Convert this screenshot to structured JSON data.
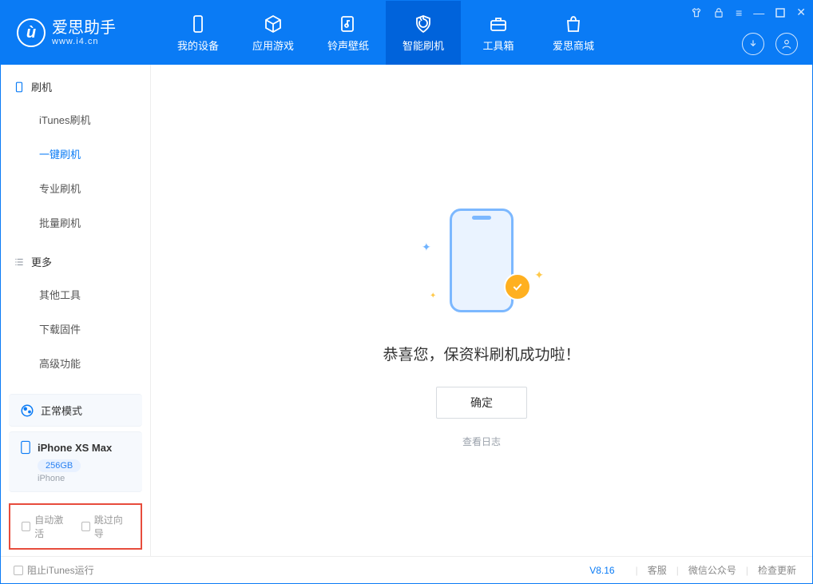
{
  "colors": {
    "primary": "#0a7bf5",
    "danger_border": "#e74c3c"
  },
  "logo": {
    "glyph": "ù",
    "title": "爱思助手",
    "subtitle": "www.i4.cn"
  },
  "tabs": {
    "mydevice": "我的设备",
    "apps": "应用游戏",
    "ring": "铃声壁纸",
    "flash": "智能刷机",
    "toolbox": "工具箱",
    "store": "爱思商城"
  },
  "sidebar": {
    "section1": "刷机",
    "items1": {
      "itunes": "iTunes刷机",
      "onekey": "一键刷机",
      "pro": "专业刷机",
      "batch": "批量刷机"
    },
    "section2": "更多",
    "items2": {
      "other": "其他工具",
      "download": "下载固件",
      "adv": "高级功能"
    }
  },
  "device": {
    "mode": "正常模式",
    "name": "iPhone XS Max",
    "capacity": "256GB",
    "type": "iPhone"
  },
  "options": {
    "auto_activate": "自动激活",
    "skip_guide": "跳过向导"
  },
  "main": {
    "message": "恭喜您，保资料刷机成功啦！",
    "ok": "确定",
    "view_log": "查看日志"
  },
  "footer": {
    "block_itunes": "阻止iTunes运行",
    "version": "V8.16",
    "support": "客服",
    "wechat": "微信公众号",
    "update": "检查更新"
  }
}
